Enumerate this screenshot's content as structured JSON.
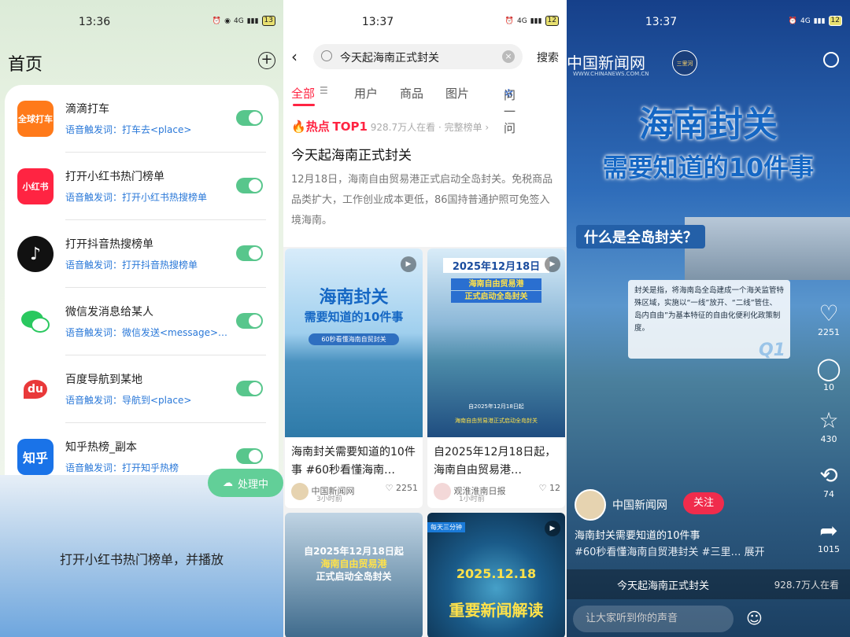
{
  "panel1": {
    "time": "13:36",
    "signal": "4G",
    "battery": "13",
    "title": "首页",
    "items": [
      {
        "name": "滴滴打车",
        "trigger": "语音触发词：打车去<place>",
        "logo": "全球打车",
        "color": "#ff7a1a"
      },
      {
        "name": "打开小红书热门榜单",
        "trigger": "语音触发词：打开小红书热搜榜单",
        "logo": "小红书",
        "color": "#ff2442"
      },
      {
        "name": "打开抖音热搜榜单",
        "trigger": "语音触发词：打开抖音热搜榜单",
        "logo": "♪",
        "color": "#111111"
      },
      {
        "name": "微信发消息给某人",
        "trigger": "语音触发词：微信发送<message>…",
        "logo": "",
        "color": "#2ac85f"
      },
      {
        "name": "百度导航到某地",
        "trigger": "语音触发词：导航到<place>",
        "logo": "du",
        "color": "#e9393a"
      },
      {
        "name": "知乎热榜_副本",
        "trigger": "语音触发词：打开知乎热榜",
        "logo": "知乎",
        "color": "#1a73e8"
      }
    ],
    "processing": "处理中",
    "command": "打开小红书热门榜单，并播放"
  },
  "panel2": {
    "time": "13:37",
    "signal": "4G",
    "battery": "12",
    "query": "今天起海南正式封关",
    "search_btn": "搜索",
    "tabs": [
      "全部",
      "用户",
      "商品",
      "图片",
      "问一问"
    ],
    "hot_label": "热点",
    "hot_rank": "TOP1",
    "hot_meta": "928.7万人在看 · 完整榜单 ›",
    "headline": "今天起海南正式封关",
    "desc": "12月18日，海南自由贸易港正式启动全岛封关。免税商品品类扩大，工作创业成本更低，86国持普通护照可免签入境海南。",
    "cards": [
      {
        "caption": "海南封关需要知道的10件事 #60秒看懂海南…",
        "author": "中国新闻网",
        "ago": "3小时前",
        "likes": "2251",
        "img1": "海南封关",
        "img2": "需要知道的10件事",
        "img3": "60秒看懂海南自贸封关"
      },
      {
        "caption": "自2025年12月18日起，海南自由贸易港…",
        "author": "观淮淮南日报",
        "ago": "1小时前",
        "likes": "12",
        "img1": "2025年12月18日",
        "img2": "海南自由贸易港",
        "img3": "正式启动全岛封关",
        "img4": "自2025年12月18日起",
        "img5": "海南自由贸易港正式启动全岛封关"
      },
      {
        "img1": "自2025年12月18日起",
        "img2": "海南自由贸易港",
        "img3": "正式启动全岛封关"
      },
      {
        "img1": "每天三分钟",
        "img2": "2025.12.18",
        "img3": "重要新闻解读"
      }
    ]
  },
  "panel3": {
    "time": "13:37",
    "signal": "4G",
    "battery": "12",
    "brand": "中国新闻网",
    "brand_en": "WWW.CHINANEWS.COM.CN",
    "badge": "三里河",
    "title1": "海南封关",
    "title2": "需要知道的10件事",
    "question": "什么是全岛封关？",
    "explain": "封关是指，将海南岛全岛建成一个海关监管特殊区域，实施以“一线”放开、“二线”管住、岛内自由”为基本特征的自由化便利化政策制度。",
    "q_label": "Q1",
    "likes": "2251",
    "comments": "10",
    "stars": "430",
    "shares": "74",
    "forwards": "1015",
    "author": "中国新闻网",
    "follow": "关注",
    "video_title": "海南封关需要知道的10件事",
    "video_desc": "#60秒看懂海南自贸港封关 #三里… 展开",
    "hot_bar": "今天起海南正式封关",
    "hot_count": "928.7万人在看",
    "comment_placeholder": "让大家听到你的声音"
  }
}
